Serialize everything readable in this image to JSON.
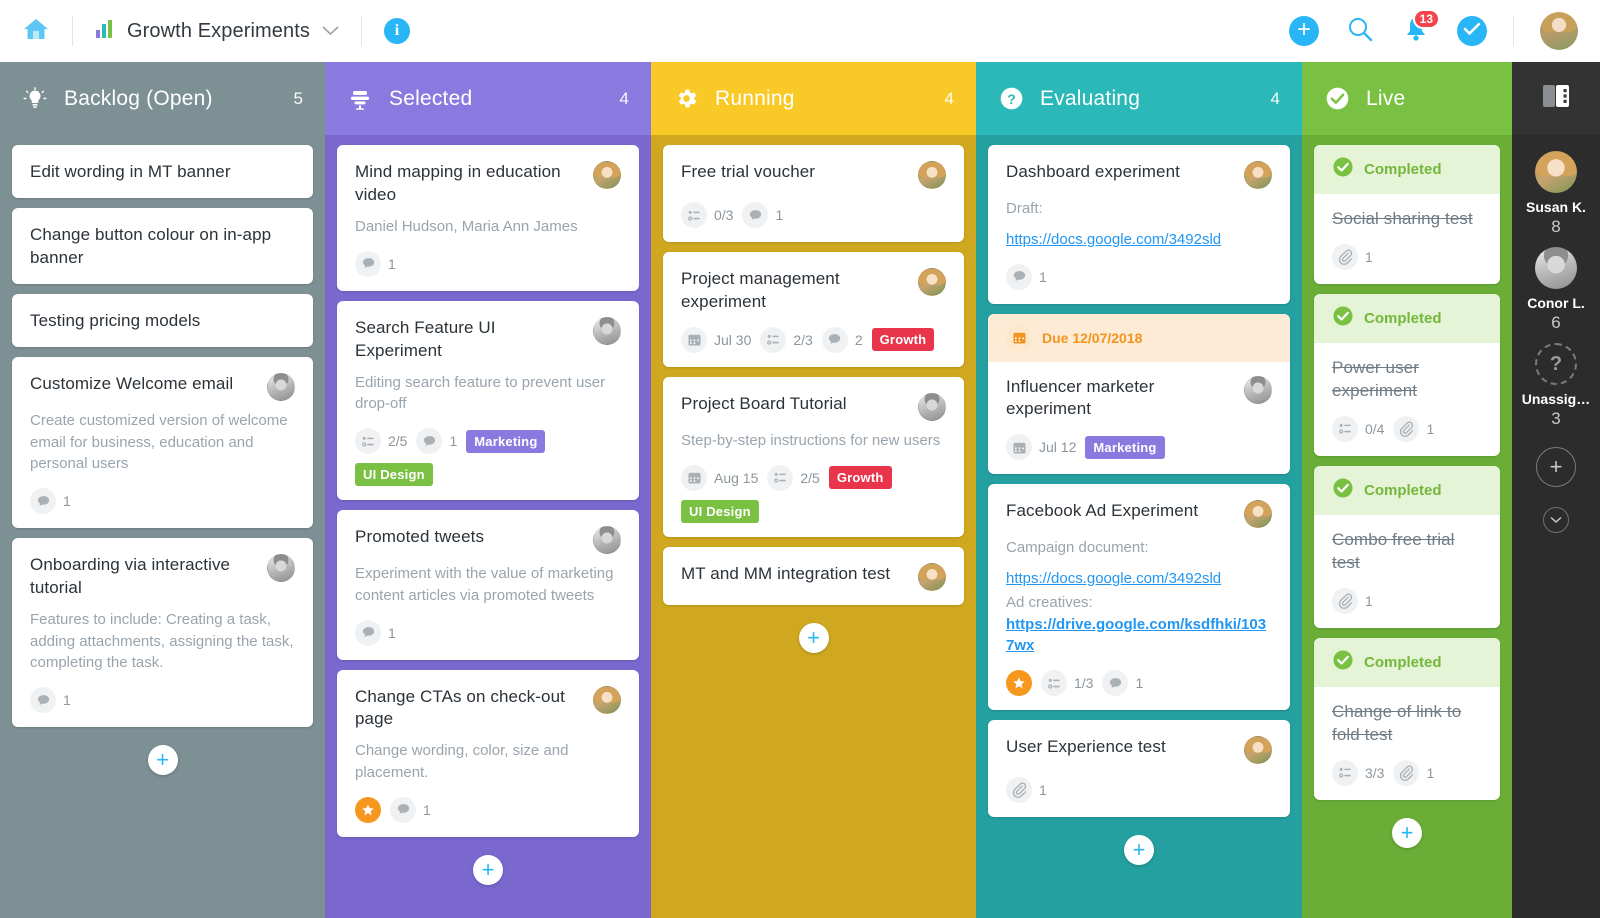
{
  "topbar": {
    "home_icon": "home-icon",
    "board_icon": "bar-chart-icon",
    "board_title": "Growth Experiments",
    "board_dropdown_icon": "chevron-down-icon",
    "info_icon": "info-icon",
    "info_label": "i",
    "add_icon": "plus-icon",
    "search_icon": "search-icon",
    "notifications_icon": "bell-icon",
    "notifications_count": "13",
    "tasks_icon": "check-circle-icon",
    "avatar": "user-avatar"
  },
  "sidebar": {
    "panel_icon": "panel-toggle-icon",
    "members": [
      {
        "name": "Susan K.",
        "count": "8",
        "avatar": "susan-avatar"
      },
      {
        "name": "Conor L.",
        "count": "6",
        "avatar": "conor-avatar"
      },
      {
        "name": "Unassig…",
        "count": "3",
        "avatar": "unassigned-avatar",
        "glyph": "?"
      }
    ],
    "add_label": "+",
    "collapse_label": "⌄"
  },
  "columns": [
    {
      "id": "backlog",
      "title": "Backlog (Open)",
      "count": "5",
      "icon": "lightbulb-icon",
      "header_color": "#7d9094",
      "body_color": "#7d9094",
      "add_label": "+",
      "cards": [
        {
          "title": "Edit wording in MT banner"
        },
        {
          "title": "Change button colour on in-app banner"
        },
        {
          "title": "Testing pricing models"
        },
        {
          "title": "Customize Welcome email",
          "avatar": "conor-avatar",
          "desc": "Create customized version of welcome email for business, education and personal users",
          "meta": [
            {
              "type": "comment",
              "icon": "comment-icon",
              "text": "1"
            }
          ]
        },
        {
          "title": "Onboarding via interactive tutorial",
          "avatar": "conor-avatar",
          "desc": "Features to include: Creating a task, adding attachments, assigning the task, completing the task.",
          "meta": [
            {
              "type": "comment",
              "icon": "comment-icon",
              "text": "1"
            }
          ]
        }
      ]
    },
    {
      "id": "selected",
      "title": "Selected",
      "count": "4",
      "icon": "stack-icon",
      "header_color": "#8a7ae0",
      "body_color": "#7a68cf",
      "add_label": "+",
      "cards": [
        {
          "title": "Mind mapping in education video",
          "avatar": "susan-avatar",
          "desc": "Daniel Hudson, Maria Ann James",
          "meta": [
            {
              "type": "comment",
              "icon": "comment-icon",
              "text": "1"
            }
          ]
        },
        {
          "title": "Search Feature UI Experiment",
          "avatar": "conor-avatar",
          "desc": "Editing search feature to prevent user drop-off",
          "meta": [
            {
              "type": "checklist",
              "icon": "checklist-icon",
              "text": "2/5"
            },
            {
              "type": "comment",
              "icon": "comment-icon",
              "text": "1"
            },
            {
              "type": "tag",
              "text": "Marketing",
              "color": "#8a7ae0"
            },
            {
              "type": "tag",
              "text": "UI Design",
              "color": "#7ac143"
            }
          ]
        },
        {
          "title": "Promoted tweets",
          "avatar": "conor-avatar",
          "desc": "Experiment with the value of marketing content articles via promoted tweets",
          "meta": [
            {
              "type": "comment",
              "icon": "comment-icon",
              "text": "1"
            }
          ]
        },
        {
          "title": "Change CTAs on check-out page",
          "avatar": "susan-avatar",
          "desc": "Change wording, color, size and placement.",
          "meta": [
            {
              "type": "star",
              "icon": "star-icon",
              "text": ""
            },
            {
              "type": "comment",
              "icon": "comment-icon",
              "text": "1"
            }
          ]
        }
      ]
    },
    {
      "id": "running",
      "title": "Running",
      "count": "4",
      "icon": "gear-icon",
      "header_color": "#f9c927",
      "body_color": "#cfa81f",
      "add_label": "+",
      "cards": [
        {
          "title": "Free trial voucher",
          "avatar": "susan-avatar",
          "meta": [
            {
              "type": "checklist",
              "icon": "checklist-icon",
              "text": "0/3"
            },
            {
              "type": "comment",
              "icon": "comment-icon",
              "text": "1"
            }
          ]
        },
        {
          "title": "Project management experiment",
          "avatar": "susan-avatar",
          "meta": [
            {
              "type": "date",
              "icon": "calendar-icon",
              "text": "Jul 30"
            },
            {
              "type": "checklist",
              "icon": "checklist-icon",
              "text": "2/3"
            },
            {
              "type": "comment",
              "icon": "comment-icon",
              "text": "2"
            },
            {
              "type": "tag",
              "text": "Growth",
              "color": "#e8354c"
            }
          ]
        },
        {
          "title": "Project Board Tutorial",
          "avatar": "conor-avatar",
          "desc": "Step-by-step instructions for new users",
          "meta": [
            {
              "type": "date",
              "icon": "calendar-icon",
              "text": "Aug 15"
            },
            {
              "type": "checklist",
              "icon": "checklist-icon",
              "text": "2/5"
            },
            {
              "type": "tag",
              "text": "Growth",
              "color": "#e8354c"
            },
            {
              "type": "tag",
              "text": "UI Design",
              "color": "#7ac143"
            }
          ]
        },
        {
          "title": "MT and MM integration test",
          "avatar": "susan-avatar"
        }
      ]
    },
    {
      "id": "evaluating",
      "title": "Evaluating",
      "count": "4",
      "icon": "question-icon",
      "header_color": "#2bb8b8",
      "body_color": "#25a0a0",
      "add_label": "+",
      "cards": [
        {
          "title": "Dashboard experiment",
          "avatar": "susan-avatar",
          "desc": "Draft:",
          "link": "https://docs.google.com/3492sld",
          "meta": [
            {
              "type": "comment",
              "icon": "comment-icon",
              "text": "1"
            }
          ]
        },
        {
          "banner": {
            "icon": "calendar-icon",
            "text": "Due 12/07/2018"
          },
          "title": "Influencer marketer experiment",
          "avatar": "conor-avatar",
          "meta": [
            {
              "type": "date",
              "icon": "calendar-icon",
              "text": "Jul 12"
            },
            {
              "type": "tag",
              "text": "Marketing",
              "color": "#8a7ae0"
            }
          ]
        },
        {
          "title": "Facebook Ad Experiment",
          "avatar": "susan-avatar",
          "desc": "Campaign document:",
          "link": "https://docs.google.com/3492sld",
          "desc2": "Ad creatives:",
          "link2": "https://drive.google.com/ksdfhki/1037wx",
          "meta": [
            {
              "type": "star",
              "icon": "star-icon",
              "text": ""
            },
            {
              "type": "checklist",
              "icon": "checklist-icon",
              "text": "1/3"
            },
            {
              "type": "comment",
              "icon": "comment-icon",
              "text": "1"
            }
          ]
        },
        {
          "title": "User Experience test",
          "avatar": "susan-avatar",
          "meta": [
            {
              "type": "attachment",
              "icon": "paperclip-icon",
              "text": "1"
            }
          ]
        }
      ]
    },
    {
      "id": "live",
      "title": "Live",
      "count": "",
      "icon": "check-circle-icon",
      "header_color": "#7ac143",
      "body_color": "#6aae38",
      "add_label": "+",
      "cards": [
        {
          "completed_banner": "Completed",
          "title": "Social sharing test",
          "strike": true,
          "meta": [
            {
              "type": "attachment",
              "icon": "paperclip-icon",
              "text": "1"
            }
          ]
        },
        {
          "completed_banner": "Completed",
          "title": "Power user experiment",
          "strike": true,
          "meta": [
            {
              "type": "checklist",
              "icon": "checklist-icon",
              "text": "0/4"
            },
            {
              "type": "attachment",
              "icon": "paperclip-icon",
              "text": "1"
            }
          ]
        },
        {
          "completed_banner": "Completed",
          "title": "Combo free trial test",
          "strike": true,
          "meta": [
            {
              "type": "attachment",
              "icon": "paperclip-icon",
              "text": "1"
            }
          ]
        },
        {
          "completed_banner": "Completed",
          "title": "Change of link to fold test",
          "strike": true,
          "meta": [
            {
              "type": "checklist",
              "icon": "checklist-icon",
              "text": "3/3"
            },
            {
              "type": "attachment",
              "icon": "paperclip-icon",
              "text": "1"
            }
          ]
        }
      ]
    }
  ]
}
